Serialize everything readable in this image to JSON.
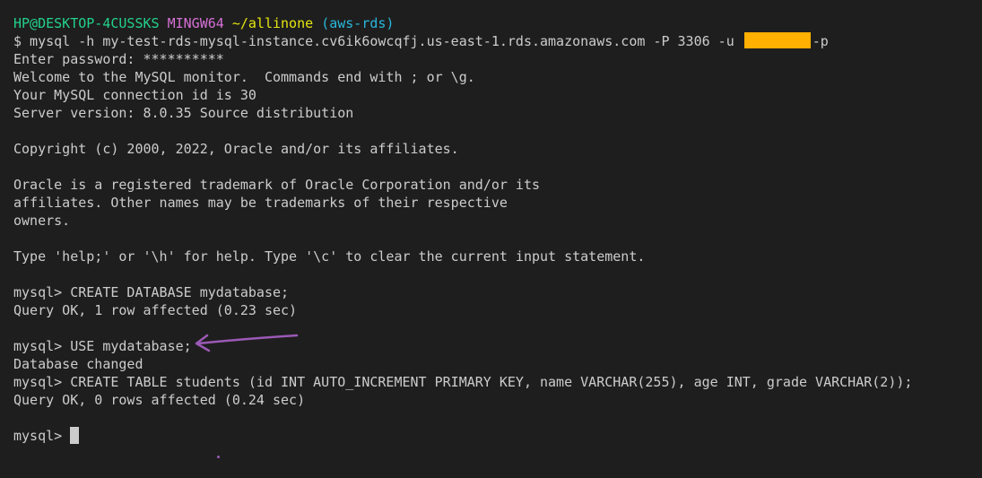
{
  "prompt": {
    "user_host": "HP@DESKTOP-4CUSSKS",
    "shell": "MINGW64",
    "path": "~/allinone",
    "branch": "(aws-rds)"
  },
  "command": {
    "before_user": "$ mysql -h my-test-rds-mysql-instance.cv6ik6owcqfj.us-east-1.rds.amazonaws.com -P 3306 -u",
    "after_user": "-p"
  },
  "output": {
    "l1": "Enter password: **********",
    "l2": "Welcome to the MySQL monitor.  Commands end with ; or \\g.",
    "l3": "Your MySQL connection id is 30",
    "l4": "Server version: 8.0.35 Source distribution",
    "l5": "Copyright (c) 2000, 2022, Oracle and/or its affiliates.",
    "l6": "Oracle is a registered trademark of Oracle Corporation and/or its",
    "l7": "affiliates. Other names may be trademarks of their respective",
    "l8": "owners.",
    "l9": "Type 'help;' or '\\h' for help. Type '\\c' to clear the current input statement.",
    "l10": "mysql> CREATE DATABASE mydatabase;",
    "l11": "Query OK, 1 row affected (0.23 sec)",
    "l12": "mysql> USE mydatabase;",
    "l13": "Database changed",
    "l14": "mysql> CREATE TABLE students (id INT AUTO_INCREMENT PRIMARY KEY, name VARCHAR(255), age INT, grade VARCHAR(2));",
    "l15": "Query OK, 0 rows affected (0.24 sec)",
    "l16": "mysql>"
  },
  "colors": {
    "background": "#1e1e1e",
    "text": "#cccccc",
    "user_host": "#23d18b",
    "shell": "#d670d6",
    "path": "#e5e510",
    "branch": "#29b8db",
    "redaction": "#ffb000",
    "annotation_arrow": "#9b59b6"
  },
  "icons": {
    "annotation": "arrow-icon",
    "cursor": "block-cursor"
  }
}
